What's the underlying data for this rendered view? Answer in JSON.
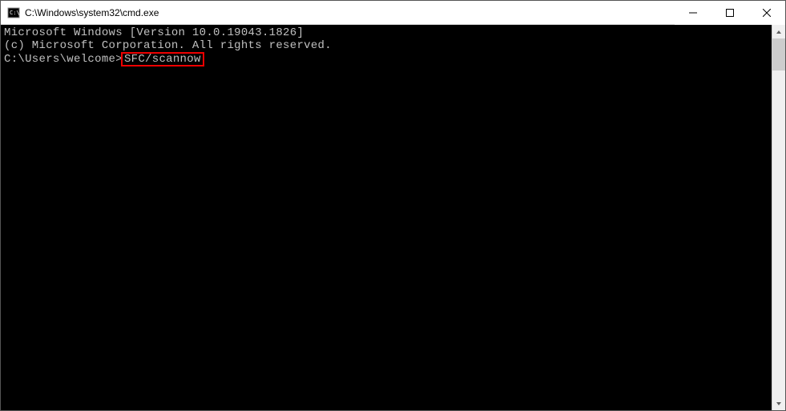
{
  "window": {
    "title": "C:\\Windows\\system32\\cmd.exe"
  },
  "terminal": {
    "line1": "Microsoft Windows [Version 10.0.19043.1826]",
    "line2": "(c) Microsoft Corporation. All rights reserved.",
    "blank": "",
    "prompt": "C:\\Users\\welcome>",
    "command": "SFC/scannow"
  }
}
